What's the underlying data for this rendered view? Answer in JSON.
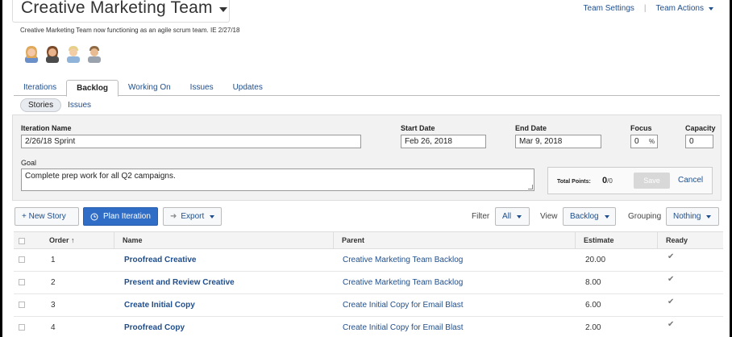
{
  "header": {
    "title": "Creative Marketing Team",
    "subtitle": "Creative Marketing Team now functioning as an agile scrum team. IE 2/27/18",
    "links": [
      "Team Settings",
      "Team Actions"
    ]
  },
  "tabs": [
    "Iterations",
    "Backlog",
    "Working On",
    "Issues",
    "Updates"
  ],
  "active_tab": "Backlog",
  "subtabs": [
    "Stories",
    "Issues"
  ],
  "iteration": {
    "name_label": "Iteration Name",
    "name_value": "2/26/18 Sprint",
    "start_label": "Start Date",
    "start_value": "Feb 26, 2018",
    "end_label": "End Date",
    "end_value": "Mar 9, 2018",
    "focus_label": "Focus",
    "focus_value": "0",
    "focus_unit": "%",
    "capacity_label": "Capacity",
    "capacity_value": "0",
    "goal_label": "Goal",
    "goal_value": "Complete prep work for all Q2 campaigns.",
    "total_points_label": "Total Points:",
    "total_points_value": "0",
    "total_points_den": "/0",
    "save_label": "Save",
    "cancel_label": "Cancel"
  },
  "toolbar": {
    "new_story": "+ New Story",
    "plan_iteration": "Plan Iteration",
    "export": "Export",
    "filter_label": "Filter",
    "filter_value": "All",
    "view_label": "View",
    "view_value": "Backlog",
    "grouping_label": "Grouping",
    "grouping_value": "Nothing"
  },
  "table": {
    "columns": [
      "Order ↑",
      "Name",
      "Parent",
      "Estimate",
      "Ready"
    ],
    "rows": [
      {
        "order": "1",
        "name": "Proofread Creative",
        "parent": "Creative Marketing Team Backlog",
        "estimate": "20.00",
        "ready": "✔"
      },
      {
        "order": "2",
        "name": "Present and Review Creative",
        "parent": "Creative Marketing Team Backlog",
        "estimate": "8.00",
        "ready": "✔"
      },
      {
        "order": "3",
        "name": "Create Initial Copy",
        "parent": "Create Initial Copy for Email Blast",
        "estimate": "6.00",
        "ready": "✔"
      },
      {
        "order": "4",
        "name": "Proofread Copy",
        "parent": "Create Initial Copy for Email Blast",
        "estimate": "2.00",
        "ready": "✔"
      }
    ]
  }
}
